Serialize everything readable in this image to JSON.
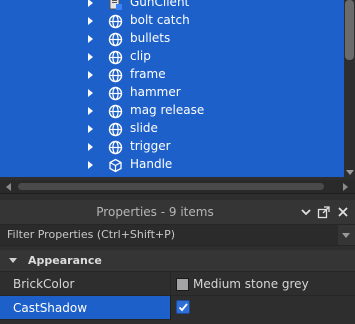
{
  "explorer": {
    "items": [
      {
        "label": "GunClient",
        "icon": "script-icon",
        "expandable": true
      },
      {
        "label": "bolt catch",
        "icon": "mesh-part-icon",
        "expandable": true
      },
      {
        "label": "bullets",
        "icon": "mesh-part-icon",
        "expandable": true
      },
      {
        "label": "clip",
        "icon": "mesh-part-icon",
        "expandable": true
      },
      {
        "label": "frame",
        "icon": "mesh-part-icon",
        "expandable": true
      },
      {
        "label": "hammer",
        "icon": "mesh-part-icon",
        "expandable": true
      },
      {
        "label": "mag release",
        "icon": "mesh-part-icon",
        "expandable": true
      },
      {
        "label": "slide",
        "icon": "mesh-part-icon",
        "expandable": true
      },
      {
        "label": "trigger",
        "icon": "mesh-part-icon",
        "expandable": true
      },
      {
        "label": "Handle",
        "icon": "part-icon",
        "expandable": true
      }
    ],
    "selection_color": "#1d60c9"
  },
  "properties": {
    "title": "Properties - 9 items",
    "filter_placeholder": "Filter Properties (Ctrl+Shift+P)",
    "sections": [
      {
        "name": "Appearance",
        "expanded": true,
        "rows": [
          {
            "name": "BrickColor",
            "value": "Medium stone grey",
            "swatch_color": "#a3a2a5"
          },
          {
            "name": "CastShadow",
            "checked": true,
            "selected": true
          }
        ]
      }
    ]
  }
}
